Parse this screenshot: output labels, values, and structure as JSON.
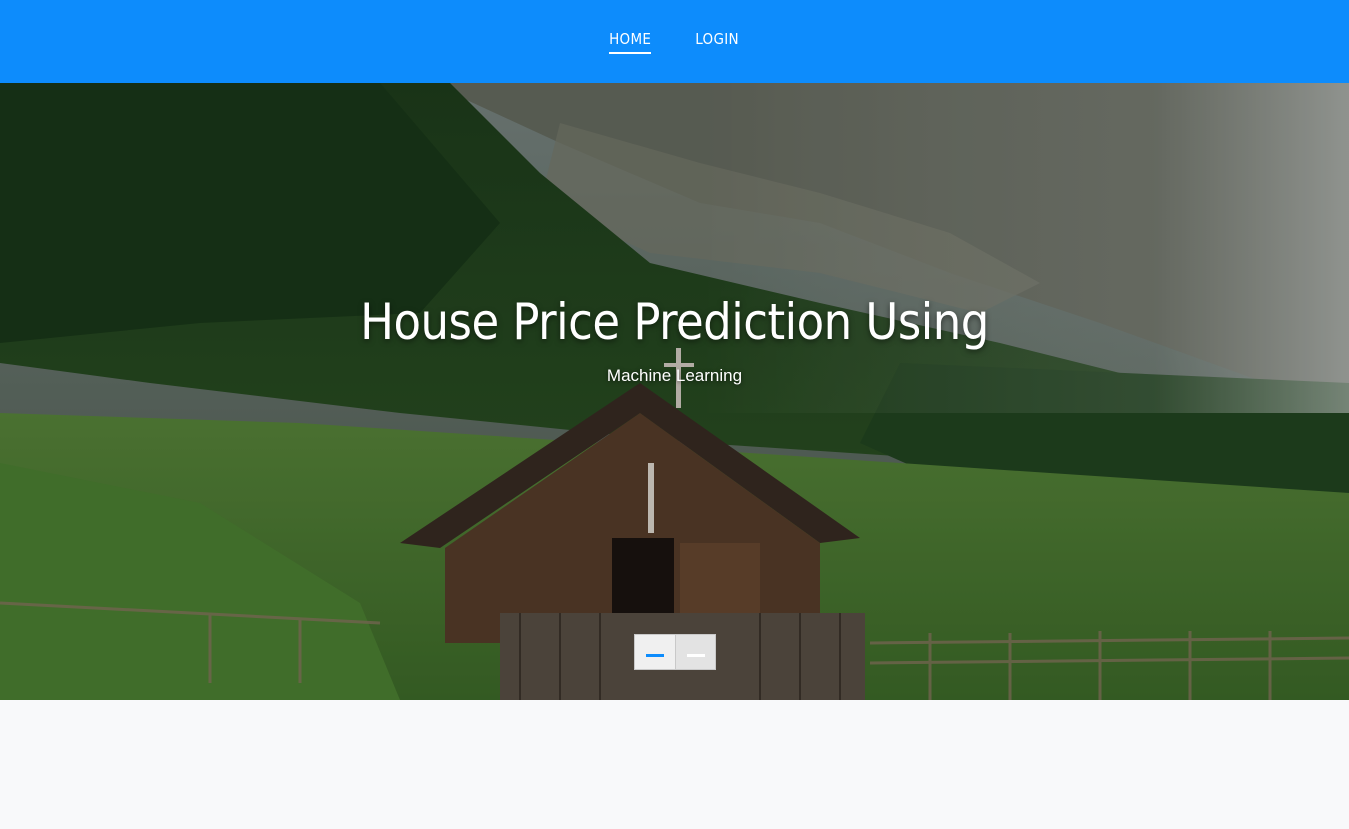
{
  "nav": {
    "items": [
      {
        "label": "HOME",
        "active": true
      },
      {
        "label": "LOGIN",
        "active": false
      }
    ]
  },
  "hero": {
    "title": "House Price Prediction Using",
    "subtitle": "Machine Learning",
    "image_description_icon": "landscape-image"
  },
  "carousel": {
    "slides": 2,
    "active_index": 0
  },
  "colors": {
    "primary": "#0d8cfc",
    "page_bg": "#f8f9fa",
    "text_on_primary": "#ffffff"
  }
}
